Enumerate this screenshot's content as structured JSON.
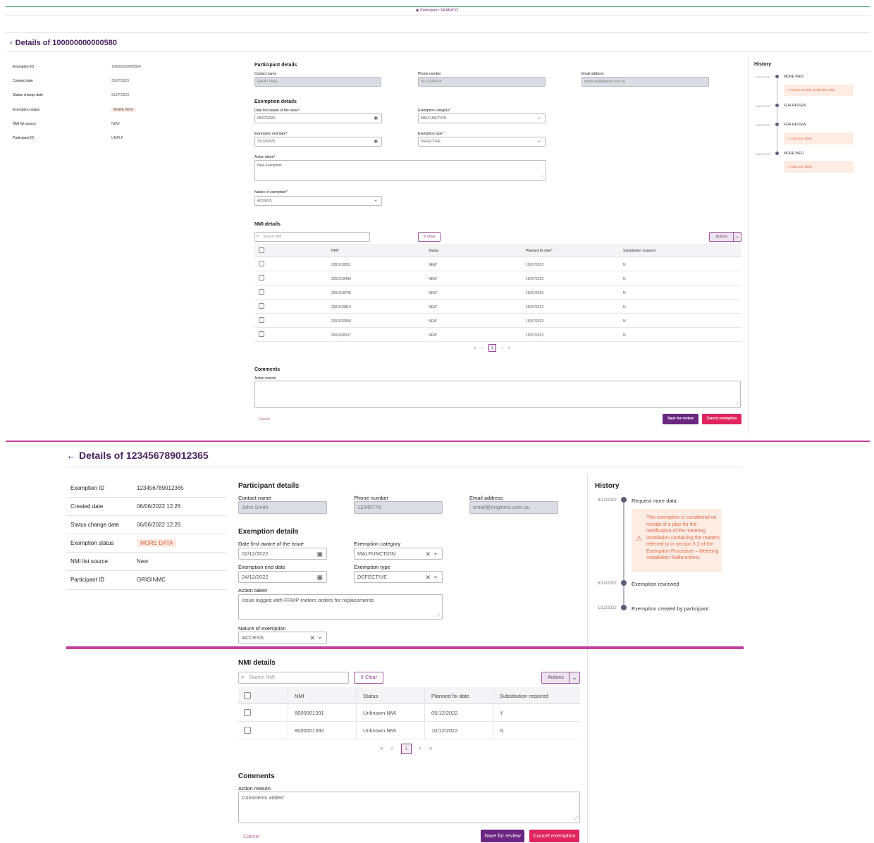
{
  "top_bar": {
    "participant": "Participant: NEMMCO"
  },
  "panel_a": {
    "title": "Details of 100000000000580",
    "summary": [
      {
        "label": "Exemption ID",
        "value": "100000000000580"
      },
      {
        "label": "Created date",
        "value": "31/07/2023"
      },
      {
        "label": "Status change date",
        "value": "31/07/2023"
      },
      {
        "label": "Exemption status",
        "value": "MORE INFO"
      },
      {
        "label": "NMI list source",
        "value": "NEW"
      },
      {
        "label": "Participant ID",
        "value": "UMPLP"
      }
    ],
    "participant": {
      "heading": "Participant details",
      "contact_label": "Contact name",
      "contact_value": "DAVID TASS",
      "phone_label": "Phone number",
      "phone_value": "03 12345678",
      "email_label": "Email address",
      "email_value": "msats.test@aemo.com.au"
    },
    "exemption": {
      "heading": "Exemption details",
      "aware_label": "Date first aware of the issue*",
      "aware_value": "05/07/2023",
      "category_label": "Exemption category*",
      "category_value": "MALFUNCTION",
      "end_label": "Exemption end date*",
      "end_value": "31/12/2023",
      "type_label": "Exemption type*",
      "type_value": "DEFECTIVE",
      "action_label": "Action taken*",
      "action_value": "New Exemption",
      "nature_label": "Nature of exemption*",
      "nature_value": "ACCESS"
    },
    "nmi": {
      "heading": "NMI details",
      "search_placeholder": "Search NMI",
      "clear": "Clear",
      "actions": "Actions",
      "columns": [
        "NMI*",
        "Status",
        "Planned fix date*",
        "Substitution required"
      ],
      "rows": [
        [
          "2001019551",
          "NEW",
          "15/07/2023",
          "N"
        ],
        [
          "2001019489",
          "NEW",
          "15/07/2023",
          "N"
        ],
        [
          "2001019745",
          "NEW",
          "15/07/2023",
          "N"
        ],
        [
          "2001019819",
          "NEW",
          "15/07/2023",
          "N"
        ],
        [
          "2001020058",
          "NEW",
          "15/07/2023",
          "N"
        ],
        [
          "2001020537",
          "NEW",
          "15/07/2023",
          "N"
        ]
      ],
      "pager": {
        "first": "«",
        "prev": "‹",
        "page": "1",
        "next": "›",
        "last": "»"
      }
    },
    "comments": {
      "heading": "Comments",
      "reason_label": "Action reason"
    },
    "buttons": {
      "cancel": "Cancel",
      "save": "Save for review",
      "cancel_exemption": "Cancel exemption"
    },
    "history": {
      "heading": "History",
      "entries": [
        {
          "date": "31/07/2023",
          "label": "MORE INFO",
          "note": "Please provide rectification plan"
        },
        {
          "date": "18/07/2023",
          "label": "FOR REVIEW",
          "note": ""
        },
        {
          "date": "18/07/2023",
          "label": "FOR REVIEW",
          "note": "Add more NMIs"
        },
        {
          "date": "18/07/2023",
          "label": "MORE INFO",
          "note": "Add more NMIs"
        }
      ]
    }
  },
  "panel_b": {
    "title": "Details of 123456789012365",
    "summary": [
      {
        "label": "Exemption ID",
        "value": "123456789012365"
      },
      {
        "label": "Created date",
        "value": "06/06/2022 12:26"
      },
      {
        "label": "Status change date",
        "value": "06/06/2022 12:26"
      },
      {
        "label": "Exemption status",
        "value": "MORE DATA"
      },
      {
        "label": "NMI list source",
        "value": "New"
      },
      {
        "label": "Participant ID",
        "value": "ORIGINMC"
      }
    ],
    "participant": {
      "heading": "Participant details",
      "contact_label": "Contact name",
      "contact_value": "John Smith",
      "phone_label": "Phone number",
      "phone_value": "12345778",
      "email_label": "Email address",
      "email_value": "email@originmc.com.au"
    },
    "exemption": {
      "heading": "Exemption details",
      "aware_label": "Date first aware of the issue",
      "aware_value": "02/12/2022",
      "category_label": "Exemption category",
      "category_value": "MALFUNCTION",
      "end_label": "Exemption end date",
      "end_value": "24/12/2022",
      "type_label": "Exemption type",
      "type_value": "DEFECTIVE",
      "action_label": "Action taken",
      "action_value": "Issue logged with FRMP meters orders for replacements",
      "nature_label": "Nature of exemption",
      "nature_value": "ACCESS"
    },
    "nmi": {
      "heading": "NMI details",
      "search_placeholder": "Search NMI",
      "clear": "Clear",
      "actions": "Actions",
      "columns": [
        "NMI",
        "Status",
        "Planned fix date",
        "Substitution required"
      ],
      "rows": [
        [
          "8000001391",
          "Unknown NMI",
          "05/12/2022",
          "Y"
        ],
        [
          "8000001392",
          "Unknown NMI",
          "10/12/2022",
          "N"
        ]
      ],
      "pager": {
        "first": "«",
        "prev": "‹",
        "page": "1",
        "next": "›",
        "last": "»"
      }
    },
    "comments": {
      "heading": "Comments",
      "reason_label": "Action reason",
      "reason_value": "Comments added"
    },
    "buttons": {
      "cancel": "Cancel",
      "save": "Save for review",
      "cancel_exemption": "Cancel exemption"
    },
    "history": {
      "heading": "History",
      "entries": [
        {
          "date": "8/12/2022",
          "label": "Request more data",
          "note": "This exemption is conditional on receipt of a plan for the rectification of the metering installation containing the matters referred to in section 3.2 of the Exemption Procedure – Metering Installation Malfunctions."
        },
        {
          "date": "5/12/2022",
          "label": "Exemption reviewed",
          "note": ""
        },
        {
          "date": "1/12/2022",
          "label": "Exemption created by participant",
          "note": ""
        }
      ]
    }
  },
  "colors": {
    "brand": "#6a2680",
    "danger": "#e0245e",
    "divider": "#c2409a",
    "status": "#e0593c"
  }
}
